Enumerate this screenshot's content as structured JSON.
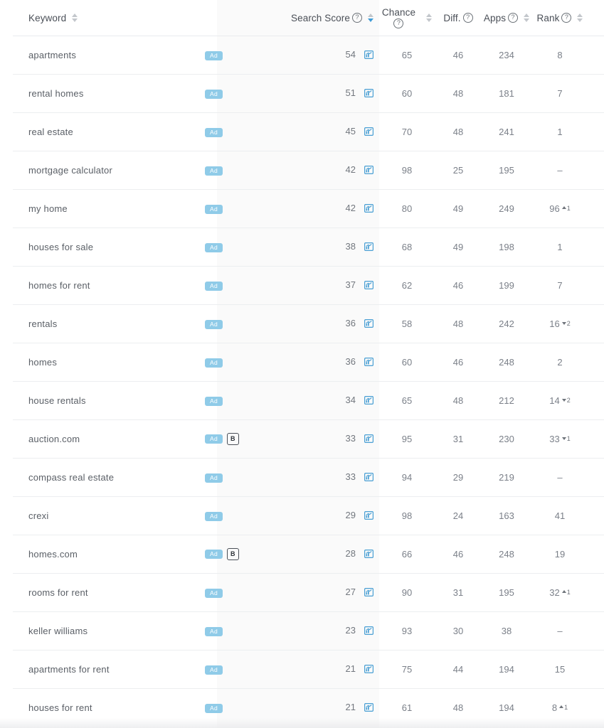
{
  "table": {
    "columns": [
      {
        "key": "keyword",
        "label": "Keyword",
        "help": false,
        "sortable": true,
        "sort_state": "none"
      },
      {
        "key": "badges",
        "label": "",
        "help": false,
        "sortable": false,
        "sort_state": "none"
      },
      {
        "key": "search_score",
        "label": "Search Score",
        "help": true,
        "sortable": true,
        "sort_state": "desc"
      },
      {
        "key": "chance",
        "label": "Chance",
        "help": true,
        "sortable": true,
        "sort_state": "none"
      },
      {
        "key": "diff",
        "label": "Diff.",
        "help": true,
        "sortable": false,
        "sort_state": "none"
      },
      {
        "key": "apps",
        "label": "Apps",
        "help": true,
        "sortable": true,
        "sort_state": "none"
      },
      {
        "key": "rank",
        "label": "Rank",
        "help": true,
        "sortable": true,
        "sort_state": "none"
      }
    ],
    "help_glyph": "?",
    "chart_icon_name": "trend-chart-icon",
    "badge_ad_label": "Ad",
    "badge_b_label": "B",
    "no_rank_value": "–",
    "rows": [
      {
        "keyword": "apartments",
        "ad": true,
        "b": false,
        "score": "54",
        "chance": "65",
        "diff": "46",
        "apps": "234",
        "rank": "8",
        "delta": "",
        "delta_dir": "none"
      },
      {
        "keyword": "rental homes",
        "ad": true,
        "b": false,
        "score": "51",
        "chance": "60",
        "diff": "48",
        "apps": "181",
        "rank": "7",
        "delta": "",
        "delta_dir": "none"
      },
      {
        "keyword": "real estate",
        "ad": true,
        "b": false,
        "score": "45",
        "chance": "70",
        "diff": "48",
        "apps": "241",
        "rank": "1",
        "delta": "",
        "delta_dir": "none"
      },
      {
        "keyword": "mortgage calculator",
        "ad": true,
        "b": false,
        "score": "42",
        "chance": "98",
        "diff": "25",
        "apps": "195",
        "rank": "–",
        "delta": "",
        "delta_dir": "none"
      },
      {
        "keyword": "my home",
        "ad": true,
        "b": false,
        "score": "42",
        "chance": "80",
        "diff": "49",
        "apps": "249",
        "rank": "96",
        "delta": "1",
        "delta_dir": "up"
      },
      {
        "keyword": "houses for sale",
        "ad": true,
        "b": false,
        "score": "38",
        "chance": "68",
        "diff": "49",
        "apps": "198",
        "rank": "1",
        "delta": "",
        "delta_dir": "none"
      },
      {
        "keyword": "homes for rent",
        "ad": true,
        "b": false,
        "score": "37",
        "chance": "62",
        "diff": "46",
        "apps": "199",
        "rank": "7",
        "delta": "",
        "delta_dir": "none"
      },
      {
        "keyword": "rentals",
        "ad": true,
        "b": false,
        "score": "36",
        "chance": "58",
        "diff": "48",
        "apps": "242",
        "rank": "16",
        "delta": "2",
        "delta_dir": "down"
      },
      {
        "keyword": "homes",
        "ad": true,
        "b": false,
        "score": "36",
        "chance": "60",
        "diff": "46",
        "apps": "248",
        "rank": "2",
        "delta": "",
        "delta_dir": "none"
      },
      {
        "keyword": "house rentals",
        "ad": true,
        "b": false,
        "score": "34",
        "chance": "65",
        "diff": "48",
        "apps": "212",
        "rank": "14",
        "delta": "2",
        "delta_dir": "down"
      },
      {
        "keyword": "auction.com",
        "ad": true,
        "b": true,
        "score": "33",
        "chance": "95",
        "diff": "31",
        "apps": "230",
        "rank": "33",
        "delta": "1",
        "delta_dir": "down"
      },
      {
        "keyword": "compass real estate",
        "ad": true,
        "b": false,
        "score": "33",
        "chance": "94",
        "diff": "29",
        "apps": "219",
        "rank": "–",
        "delta": "",
        "delta_dir": "none"
      },
      {
        "keyword": "crexi",
        "ad": true,
        "b": false,
        "score": "29",
        "chance": "98",
        "diff": "24",
        "apps": "163",
        "rank": "41",
        "delta": "",
        "delta_dir": "none"
      },
      {
        "keyword": "homes.com",
        "ad": true,
        "b": true,
        "score": "28",
        "chance": "66",
        "diff": "46",
        "apps": "248",
        "rank": "19",
        "delta": "",
        "delta_dir": "none"
      },
      {
        "keyword": "rooms for rent",
        "ad": true,
        "b": false,
        "score": "27",
        "chance": "90",
        "diff": "31",
        "apps": "195",
        "rank": "32",
        "delta": "1",
        "delta_dir": "up"
      },
      {
        "keyword": "keller williams",
        "ad": true,
        "b": false,
        "score": "23",
        "chance": "93",
        "diff": "30",
        "apps": "38",
        "rank": "–",
        "delta": "",
        "delta_dir": "none"
      },
      {
        "keyword": "apartments for rent",
        "ad": true,
        "b": false,
        "score": "21",
        "chance": "75",
        "diff": "44",
        "apps": "194",
        "rank": "15",
        "delta": "",
        "delta_dir": "none"
      },
      {
        "keyword": "houses for rent",
        "ad": true,
        "b": false,
        "score": "21",
        "chance": "61",
        "diff": "48",
        "apps": "194",
        "rank": "8",
        "delta": "1",
        "delta_dir": "up"
      }
    ]
  },
  "colors": {
    "ad_badge_bg": "#8fcbe8",
    "chart_icon": "#4a9fd4",
    "active_sort": "#3e9bd6",
    "score_band_bg": "#fafafa",
    "row_border": "#eceef0",
    "text": "#7b8089"
  }
}
